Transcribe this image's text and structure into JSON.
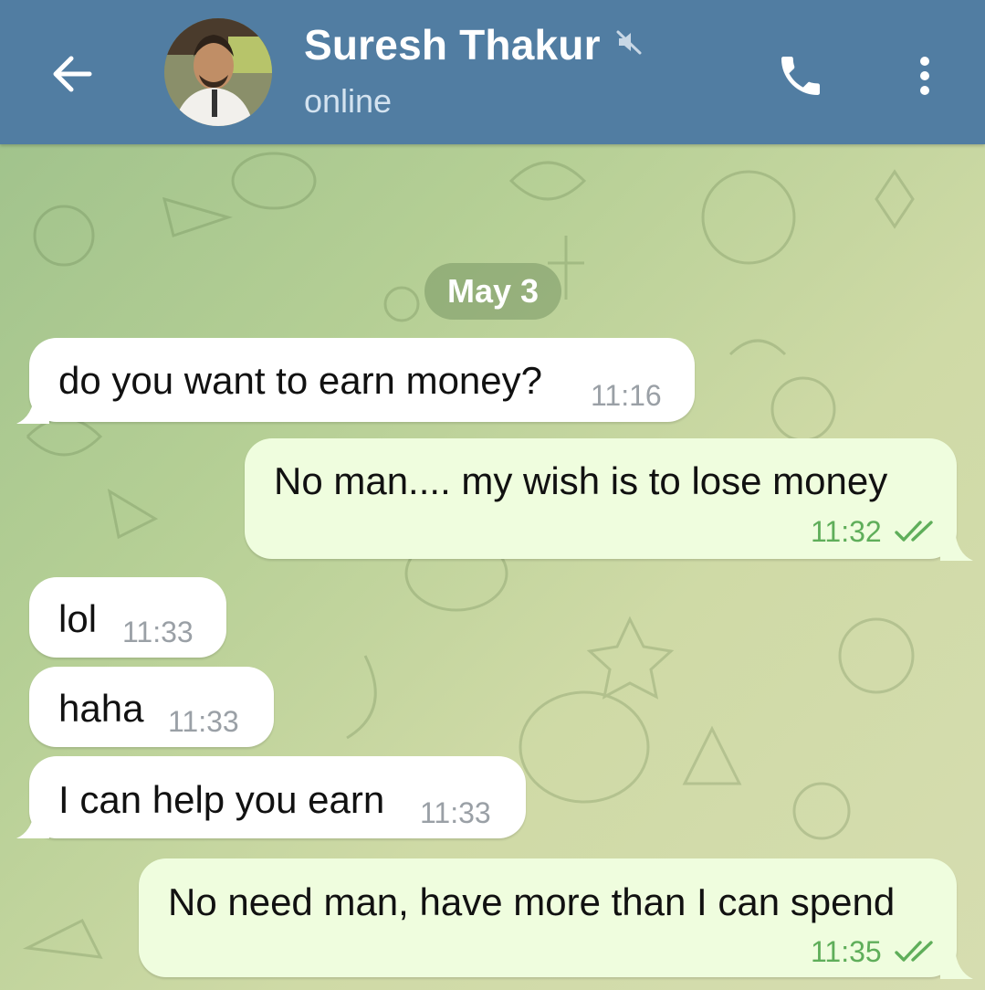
{
  "header": {
    "contact_name": "Suresh Thakur",
    "status": "online",
    "accent_color": "#517da2"
  },
  "icons": {
    "back": "arrow-left-icon",
    "mute": "muted-speaker-icon",
    "call": "phone-icon",
    "menu": "more-vertical-icon"
  },
  "chat": {
    "date_label": "May 3",
    "messages": [
      {
        "direction": "incoming",
        "text": "do you want to earn money?",
        "time": "11:16"
      },
      {
        "direction": "outgoing",
        "text": "No man.... my wish is to lose money",
        "time": "11:32",
        "read": true
      },
      {
        "direction": "incoming",
        "text": "lol",
        "time": "11:33"
      },
      {
        "direction": "incoming",
        "text": "haha",
        "time": "11:33"
      },
      {
        "direction": "incoming",
        "text": "I can help you earn",
        "time": "11:33"
      },
      {
        "direction": "outgoing",
        "text": "No need man, have more than I can spend",
        "time": "11:35",
        "read": true
      }
    ]
  },
  "colors": {
    "incoming_bubble": "#ffffff",
    "outgoing_bubble": "#effdde",
    "outgoing_time": "#5fae5a"
  }
}
